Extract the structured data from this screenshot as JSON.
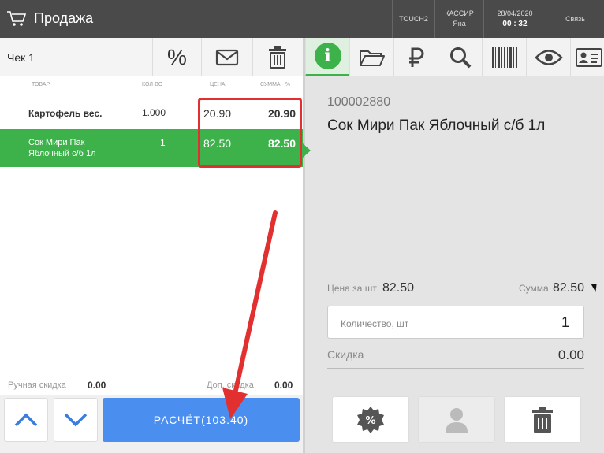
{
  "header": {
    "title": "Продажа",
    "terminal": "TOUCH2",
    "cashier_label": "КАССИР",
    "cashier_name": "Яна",
    "date": "28/04/2020",
    "time": "00 : 32",
    "link_label": "Связь"
  },
  "check": {
    "title": "Чек 1",
    "discount_symbol": "%"
  },
  "columns": {
    "product": "ТОВАР",
    "qty": "КОЛ-ВО",
    "price": "ЦЕНА",
    "sum": "СУММА - %"
  },
  "rows": [
    {
      "name": "Картофель вес.",
      "qty": "1.000",
      "price": "20.90",
      "sum": "20.90",
      "selected": false
    },
    {
      "name_line1": "Сок Мири Пак",
      "name_line2": "Яблочный с/б 1л",
      "qty": "1",
      "price": "82.50",
      "sum": "82.50",
      "selected": true
    }
  ],
  "footer": {
    "manual_discount_label": "Ручная скидка",
    "manual_discount_value": "0.00",
    "extra_discount_label": "Доп. скидка",
    "extra_discount_value": "0.00",
    "pay_label": "РАСЧЁТ(103.40)"
  },
  "detail": {
    "code": "100002880",
    "name": "Сок Мири Пак Яблочный с/б 1л",
    "unit_price_label": "Цена за шт",
    "unit_price": "82.50",
    "sum_label": "Сумма",
    "sum": "82.50",
    "qty_label": "Количество, шт",
    "qty": "1",
    "discount_label": "Скидка",
    "discount": "0.00"
  },
  "tabs": [
    "info-icon",
    "folder-icon",
    "ruble-icon",
    "search-icon",
    "barcode-icon",
    "eye-icon",
    "contact-card-icon"
  ],
  "colors": {
    "topbar": "#4a4a4a",
    "selected_row": "#3db14a",
    "pay_button": "#4a8ef0",
    "annotation": "#e23030"
  }
}
